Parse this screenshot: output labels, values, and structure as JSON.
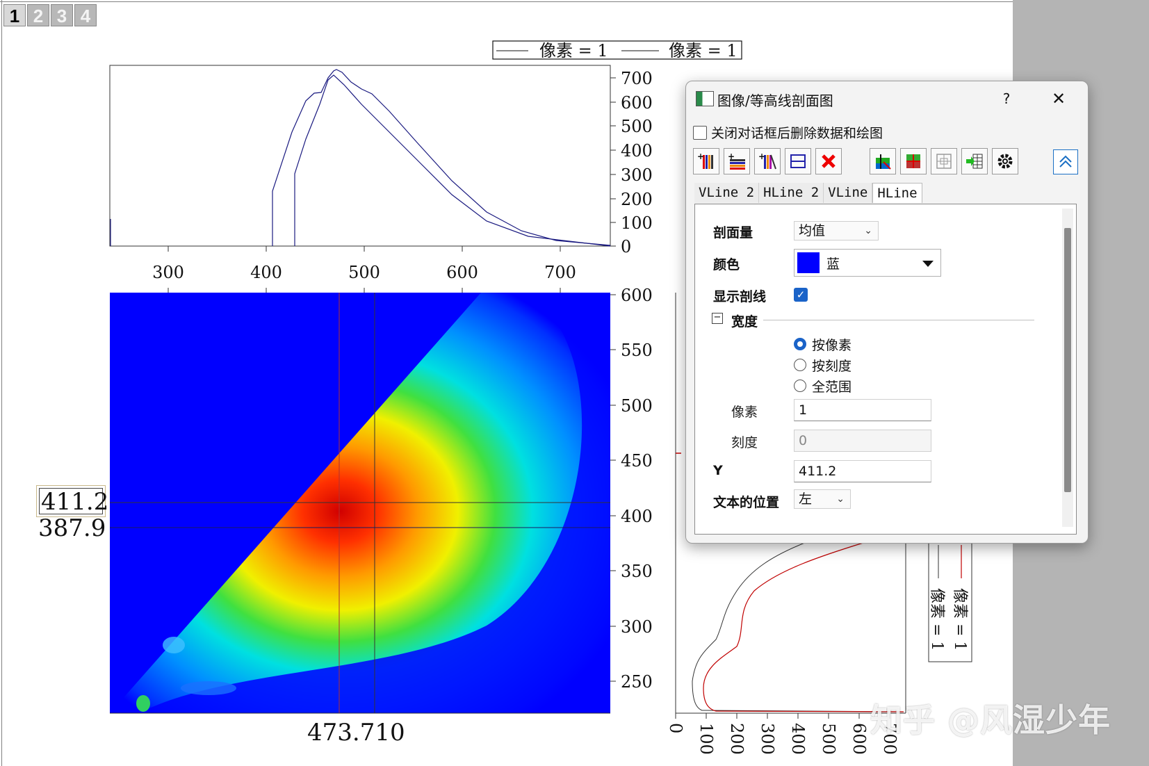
{
  "layer_tabs": [
    "1",
    "2",
    "3",
    "4"
  ],
  "top_legend": {
    "entries": [
      "像素 = 1",
      "像素 = 1"
    ]
  },
  "top_plot": {
    "x_ticks": [
      "300",
      "400",
      "500",
      "600",
      "700"
    ],
    "y_ticks": [
      "700",
      "600",
      "500",
      "400",
      "300",
      "200",
      "100",
      "0"
    ]
  },
  "contour_plot": {
    "y_ticks": [
      "600",
      "550",
      "500",
      "450",
      "400",
      "350",
      "300",
      "250"
    ],
    "label_y1": "411.2",
    "label_y2": "387.9",
    "label_x": "473.710"
  },
  "right_plot": {
    "x_ticks": [
      "0",
      "100",
      "200",
      "300",
      "400",
      "500",
      "600",
      "700"
    ],
    "legend_entries": [
      "像素 = 1",
      "像素 = 1"
    ]
  },
  "watermark": "知乎 @风湿少年",
  "colors": {
    "contour_background": "#0000ff",
    "profile_red": "#c00000",
    "accent": "#1a63c8"
  },
  "dialog": {
    "title": "图像/等高线剖面图",
    "help": "?",
    "close": "✕",
    "delete_on_close_label": "关闭对话框后删除数据和绘图",
    "tabs": [
      "VLine 2",
      "HLine 2",
      "VLine",
      "HLine"
    ],
    "active_tab": "HLine",
    "fields": {
      "profile_quantity_label": "剖面量",
      "profile_quantity_value": "均值",
      "color_label": "颜色",
      "color_value": "蓝",
      "show_profile_label": "显示剖线",
      "width_group_label": "宽度",
      "radio_by_pixel": "按像素",
      "radio_by_scale": "按刻度",
      "radio_full_range": "全范围",
      "pixel_label": "像素",
      "pixel_value": "1",
      "scale_label": "刻度",
      "scale_value": "0",
      "y_label": "Y",
      "y_value": "411.2",
      "text_position_label": "文本的位置",
      "text_position_value": "左"
    },
    "icons": [
      "add-vline-icon",
      "add-hline-icon",
      "add-arbitrary-line-icon",
      "horizontal-split-icon",
      "delete-icon",
      "image-profile-icon",
      "crosshair-icon",
      "grid-icon",
      "export-table-icon",
      "gear-icon",
      "collapse-icon"
    ]
  }
}
